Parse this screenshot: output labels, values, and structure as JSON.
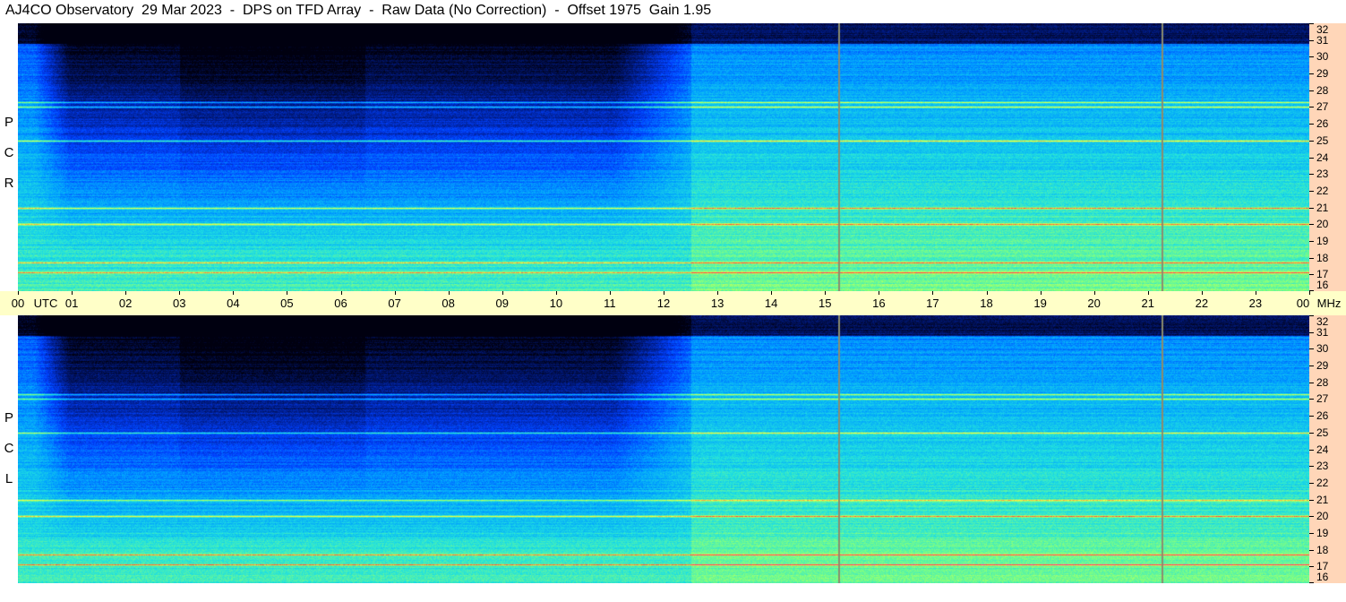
{
  "title": "AJ4CO Observatory  29 Mar 2023  -  DPS on TFD Array  -  Raw Data (No Correction)  -  Offset 1975  Gain 1.95",
  "panels": [
    {
      "label_letters": [
        "R",
        "C",
        "P"
      ]
    },
    {
      "label_letters": [
        "L",
        "C",
        "P"
      ]
    }
  ],
  "time_axis": {
    "labels": [
      "00",
      "UTC",
      "01",
      "02",
      "03",
      "04",
      "05",
      "06",
      "07",
      "08",
      "09",
      "10",
      "11",
      "12",
      "13",
      "14",
      "15",
      "16",
      "17",
      "18",
      "19",
      "20",
      "21",
      "22",
      "23",
      "00",
      "MHz"
    ]
  },
  "chart_data": {
    "type": "heatmap",
    "title": "AJ4CO Observatory  29 Mar 2023  -  DPS on TFD Array  -  Raw Data (No Correction)  -  Offset 1975  Gain 1.95",
    "x_unit": "UTC",
    "x_range": [
      0,
      24
    ],
    "x_ticks": [
      "00",
      "01",
      "02",
      "03",
      "04",
      "05",
      "06",
      "07",
      "08",
      "09",
      "10",
      "11",
      "12",
      "13",
      "14",
      "15",
      "16",
      "17",
      "18",
      "19",
      "20",
      "21",
      "22",
      "23",
      "00"
    ],
    "y_unit": "MHz",
    "y_range": [
      16,
      32
    ],
    "y_ticks": [
      "16",
      "17",
      "18",
      "19",
      "20",
      "21",
      "22",
      "23",
      "24",
      "25",
      "26",
      "27",
      "28",
      "29",
      "30",
      "31",
      "32"
    ],
    "series": [
      {
        "name": "RCP"
      },
      {
        "name": "LCP"
      }
    ],
    "colormap": [
      "#000010",
      "#001a80",
      "#0040ff",
      "#00a0ff",
      "#20e0e0",
      "#80ff80",
      "#ffff40",
      "#ff4040",
      "#ff00ff"
    ],
    "vertical_markers_utc": [
      15.25,
      21.25
    ],
    "bright_freqs_mhz": [
      27.0,
      27.3,
      25.0,
      20.0,
      21.0,
      17.7,
      17.1
    ],
    "axis_colors": {
      "freq_axis_bg": "#ffd6b8",
      "time_axis_bg": "#ffffc8"
    }
  }
}
